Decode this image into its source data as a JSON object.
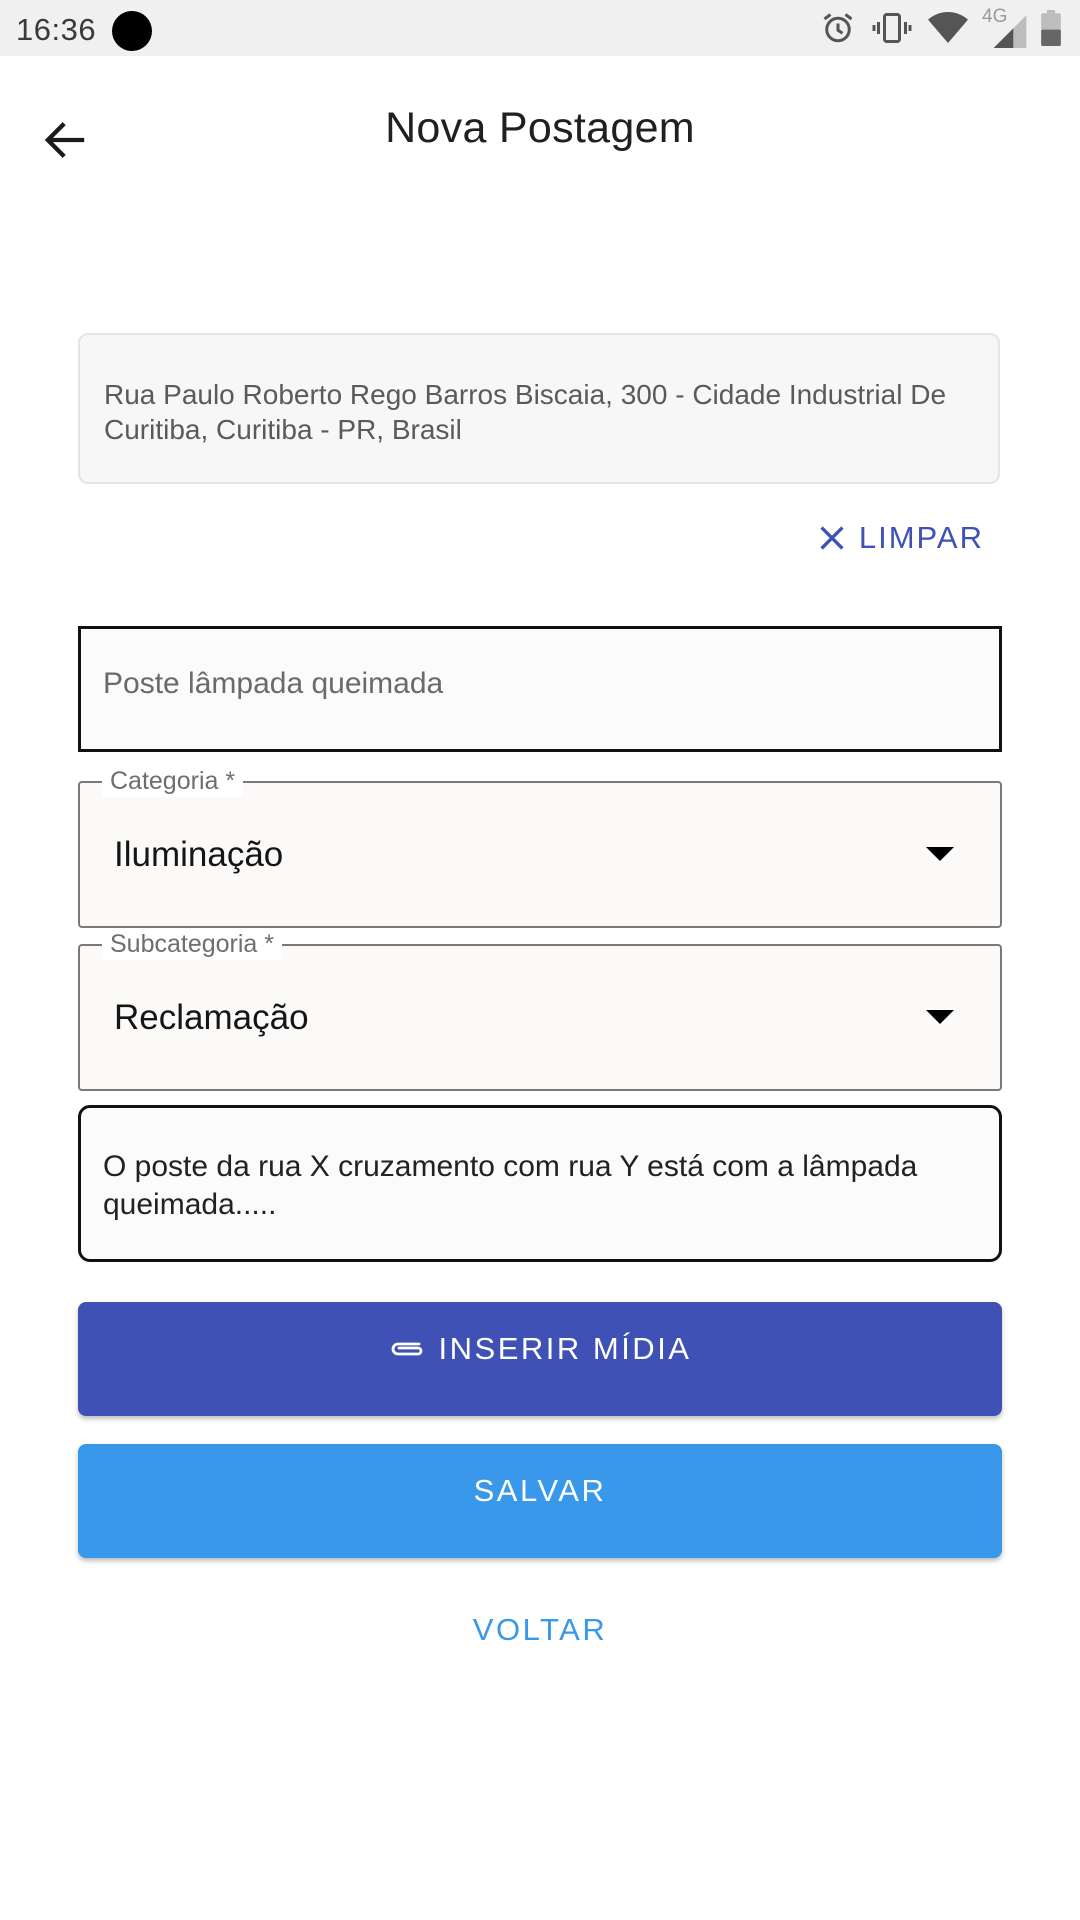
{
  "status_bar": {
    "time": "16:36",
    "network_label": "4G"
  },
  "appbar": {
    "title": "Nova Postagem",
    "back_icon": "arrow-back-icon"
  },
  "address": {
    "value": "Rua Paulo Roberto Rego Barros Biscaia, 300 - Cidade Industrial De Curitiba, Curitiba - PR, Brasil"
  },
  "limpar": {
    "label": "LIMPAR",
    "icon": "close-icon"
  },
  "form": {
    "title_placeholder": "Poste lâmpada queimada",
    "category": {
      "label": "Categoria *",
      "value": "Iluminação"
    },
    "subcategory": {
      "label": "Subcategoria *",
      "value": "Reclamação"
    },
    "description": "O poste da rua X cruzamento com rua Y está com a lâmpada queimada....."
  },
  "buttons": {
    "media_label": "INSERIR MÍDIA",
    "media_icon": "paperclip-icon",
    "save_label": "SALVAR",
    "back_label": "VOLTAR"
  },
  "colors": {
    "primary": "#3f51b5",
    "accent": "#3998ea",
    "status_bar_bg": "#f0f0f0"
  }
}
